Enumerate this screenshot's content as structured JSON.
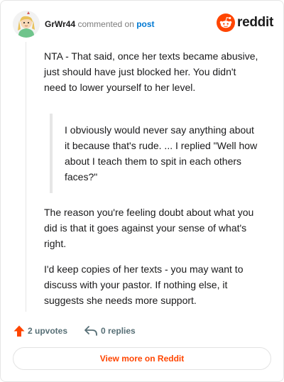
{
  "header": {
    "username": "GrWr44",
    "action": "commented on",
    "post_link": "post",
    "brand": "reddit"
  },
  "comment": {
    "paragraph1": "NTA - That said, once her texts became abusive, just should have just blocked her. You didn't need to lower yourself to her level.",
    "quote": "I obviously would never say anything about it because that's rude. ... I replied \"Well how about I teach them to spit in each others faces?\"",
    "paragraph2": "The reason you're feeling doubt about what you did is that it goes against your sense of what's right.",
    "paragraph3": "I'd keep copies of her texts - you may want to discuss with your pastor. If nothing else, it suggests she needs more support."
  },
  "footer": {
    "upvotes": "2 upvotes",
    "replies": "0 replies"
  },
  "view_more_label": "View more on Reddit",
  "icons": {
    "avatar": "avatar-illustration",
    "brand": "reddit-logo-icon",
    "upvote": "upvote-arrow-icon",
    "reply": "reply-arrow-icon"
  },
  "colors": {
    "brand_orange": "#ff4500",
    "link_blue": "#0079d3",
    "muted_text": "#7c7c7c",
    "footer_text": "#576f76"
  }
}
